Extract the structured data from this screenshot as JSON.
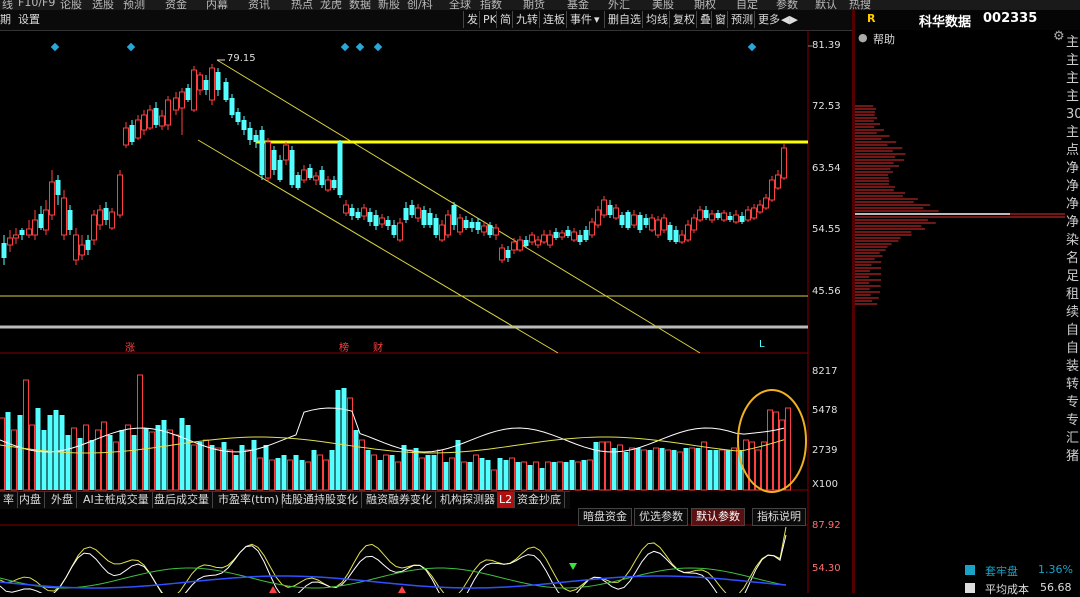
{
  "topbar": {
    "items": [
      "线",
      "F10/F9",
      "论股",
      "选股",
      "预测",
      "资金",
      "内幕",
      "资讯",
      "热点",
      "龙虎",
      "数据",
      "新股",
      "创/科",
      "全球",
      "指数",
      "期货",
      "基金",
      "外汇",
      "美股",
      "期权",
      "自定",
      "参数",
      "默认",
      "热搜"
    ]
  },
  "toolbar": {
    "left": [
      "期",
      "设置"
    ],
    "right": [
      "发",
      "PK",
      "简",
      "九转",
      "连板",
      "事件",
      "删自选",
      "均线",
      "复权",
      "叠",
      "窗",
      "预测",
      "更多"
    ]
  },
  "stock": {
    "title": "科华数据",
    "code": "002335",
    "flag": "R",
    "help": "帮助"
  },
  "price_axis": [
    "81.39",
    "72.53",
    "63.54",
    "54.55",
    "45.56"
  ],
  "vol_axis": [
    "8217",
    "5478",
    "2739",
    "X100"
  ],
  "ind_axis": [
    "87.92",
    "54.30"
  ],
  "annotations": {
    "high": "79.15",
    "zhang": "涨",
    "bang": "榜",
    "cai": "财",
    "L": "L"
  },
  "tabs": [
    "率",
    "内盘",
    "外盘",
    "AI主桩成交量",
    "盘后成交量",
    "市盈率(ttm)",
    "陆股通持股变化",
    "融资融券变化",
    "机构探测器",
    "L2",
    "资金抄底"
  ],
  "tabs2": {
    "items": [
      "暗盘资金",
      "优选参数",
      "默认参数",
      "指标说明"
    ],
    "active": 2
  },
  "right_panel": {
    "sidebar_chars": [
      "主",
      "主",
      "主",
      "主",
      "30",
      "主",
      "点",
      "净",
      "净",
      "净",
      "净",
      "染",
      "名",
      "足",
      "租",
      "续",
      "自",
      "自",
      "装",
      "转",
      "专",
      "专",
      "汇",
      "猪"
    ],
    "stats": [
      {
        "label": "套牢盘",
        "value": "1.36%",
        "color": "#1aa3c7"
      },
      {
        "label": "平均成本",
        "value": "56.68",
        "color": "#ddd"
      }
    ]
  },
  "colors": {
    "up": "#ff4040",
    "down": "#54ffff",
    "ma_yellow": "#e0e050",
    "hline": "#ffff00",
    "circle": "#f0b020"
  }
}
